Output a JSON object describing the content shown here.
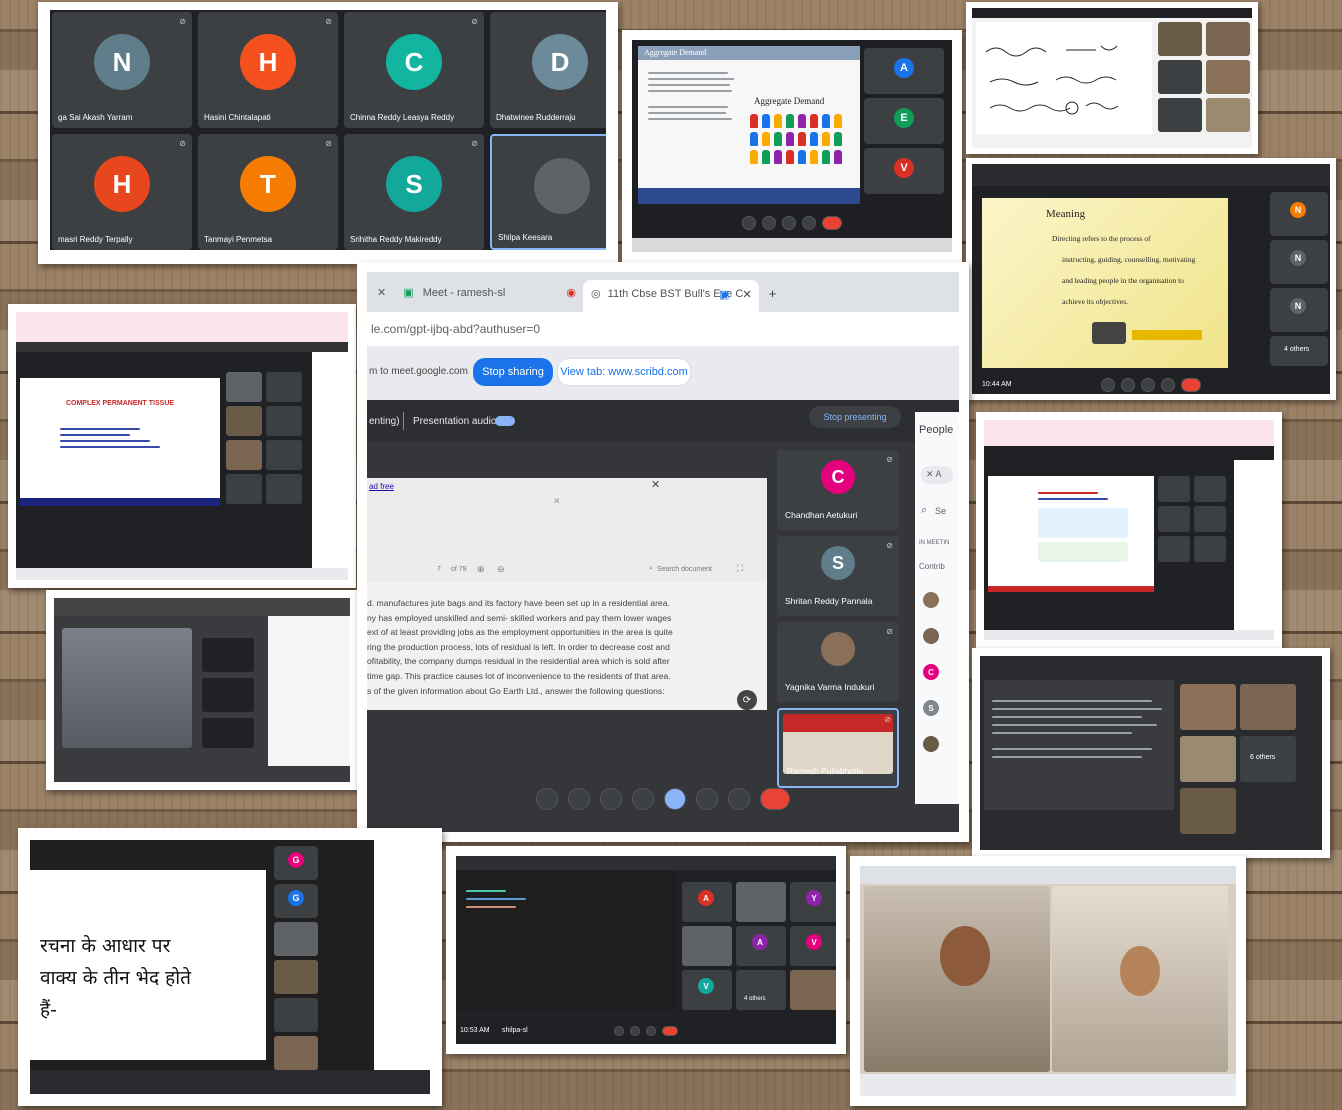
{
  "collage": {
    "p1": {
      "tiles": [
        {
          "initial": "N",
          "name": "ga Sai Akash Yarram",
          "color": "#5f7d8a"
        },
        {
          "initial": "H",
          "name": "Hasini Chintalapati",
          "color": "#f4511e"
        },
        {
          "initial": "C",
          "name": "Chinna Reddy Leasya Reddy",
          "color": "#12b5a0"
        },
        {
          "initial": "D",
          "name": "Dhatwinee Rudderraju",
          "color": "#6d8a9a"
        },
        {
          "initial": "H",
          "name": "masri Reddy Terpally",
          "color": "#e8471e"
        },
        {
          "initial": "T",
          "name": "Tanmayi Penmetsa",
          "color": "#f57c00"
        },
        {
          "initial": "S",
          "name": "Srihitha Reddy Makireddy",
          "color": "#12a89a"
        },
        {
          "initial": "",
          "name": "Shilpa Keesara",
          "color": "#5f6368"
        }
      ]
    },
    "p2": {
      "slide_header": "Aggregate Demand",
      "slide_title": "Aggregate Demand",
      "tiles": [
        {
          "initial": "A",
          "color": "#1a73e8"
        },
        {
          "initial": "E",
          "color": "#0f9d58"
        },
        {
          "initial": "V",
          "color": "#d93025"
        }
      ]
    },
    "p4": {
      "title": "Meaning",
      "lines": [
        "Directing refers to the process of",
        "instructing, guiding, counselling, motivating",
        "and leading people in the organisation to",
        "achieve its objectives."
      ],
      "clock": "10:44 AM",
      "people": [
        {
          "initial": "N",
          "color": "#f57c00"
        },
        {
          "initial": "N",
          "color": "#5f6368"
        },
        {
          "initial": "N",
          "color": "#5f6368"
        }
      ],
      "others": "4 others"
    },
    "p5": {
      "slide_title": "COMPLEX PERMANENT TISSUE"
    },
    "p7": {
      "tab1": "Meet - ramesh-sl",
      "tab2": "11th Cbse BST Bull's Eye C",
      "url": "le.com/gpt-ijbq-abd?authuser=0",
      "share_text": "m to meet.google.com",
      "stop_sharing": "Stop sharing",
      "view_tab": "View tab: www.scribd.com",
      "presenting": "enting)",
      "presentation_audio": "Presentation audio",
      "stop_presenting": "Stop presenting",
      "people": "People",
      "in_meeting": "IN MEETIN",
      "contrib": "Contrib",
      "search": "Se",
      "ad_free": "ad free",
      "page_num": "7",
      "page_total": "of 79",
      "search_doc": "Search document",
      "doc_lines": [
        "d. manufactures jute bags and its factory have been set up in a residential area.",
        "ny has employed unskilled and semi- skilled workers and pay them lower wages",
        "ext of at least providing jobs as the employment opportunities in the area is quite",
        "ring the production process, lots of residual is left. In order to decrease cost and",
        "ofitability, the company dumps residual in the residential area which is sold after",
        " time gap. This practice causes lot of inconvenience to the residents of that area.",
        "s of the given information about Go Earth Ltd., answer the following questions:"
      ],
      "participants": [
        {
          "initial": "C",
          "name": "Chandhan Aetukuri",
          "color": "#e5007e"
        },
        {
          "initial": "S",
          "name": "Shritan Reddy Pannala",
          "color": "#5f7d8a"
        },
        {
          "initial": "",
          "name": "Yagnika Varma Indukuri",
          "color": "#5f6368"
        },
        {
          "initial": "",
          "name": "Ramesh Pullabhotla",
          "color": "#5f6368"
        }
      ]
    },
    "p9": {
      "clock": "10:53 AM",
      "user": "shilpa-sl",
      "others": "4 others"
    },
    "p10": {
      "hindi_lines": [
        "रचना के आधार पर",
        "वाक्य के तीन भेद होते",
        "हैं-"
      ],
      "tiles": [
        {
          "initial": "G",
          "color": "#e5007e"
        },
        {
          "initial": "G",
          "color": "#1a73e8"
        }
      ]
    },
    "p11": {
      "others": "6 others"
    }
  }
}
